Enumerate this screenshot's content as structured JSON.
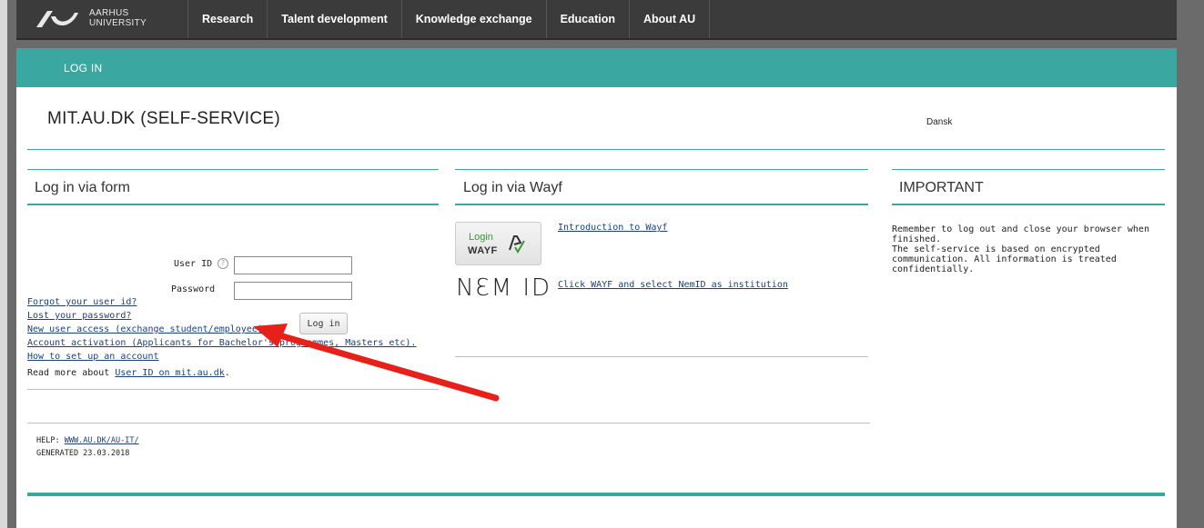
{
  "topbar": {
    "logo_line1": "AARHUS",
    "logo_line2": "UNIVERSITY",
    "nav": [
      "Research",
      "Talent development",
      "Knowledge exchange",
      "Education",
      "About AU"
    ]
  },
  "strip": {
    "label": "LOG IN"
  },
  "page": {
    "title": "MIT.AU.DK (SELF-SERVICE)",
    "language": "Dansk"
  },
  "form": {
    "heading": "Log in via form",
    "userid_label": "User ID",
    "help_icon": "?",
    "password_label": "Password",
    "userid_value": "",
    "password_value": "",
    "login_button": "Log in",
    "links": [
      "Forgot your user id?",
      "Lost your password?",
      "New user access (exchange student/employee).",
      "Account activation (Applicants for Bachelor's programmes, Masters etc).",
      "How to set up an account"
    ],
    "read_more_prefix": "Read more about ",
    "read_more_link": "User ID on mit.au.dk",
    "read_more_suffix": "."
  },
  "wayf": {
    "heading": "Log in via Wayf",
    "button_top": "Login",
    "button_bottom": "WAYF",
    "intro_link": "Introduction to Wayf",
    "nemid_logo": "NƐM ID",
    "nemid_link": "Click WAYF and select NemID as institution"
  },
  "important": {
    "heading": "IMPORTANT",
    "text": "Remember to log out and close your browser when finished.\nThe self-service is based on encrypted communication. All information is treated confidentially."
  },
  "footer": {
    "help_label": "HELP:",
    "help_link": "WWW.AU.DK/AU-IT/",
    "generated": "GENERATED 23.03.2018"
  },
  "colors": {
    "teal": "#3aa7a0",
    "topbar": "#3b3b3b",
    "arrow": "#e8201a"
  },
  "icons": {
    "logo": "aarhus-wave-logo",
    "help": "help-circle-icon",
    "wayf": "wayf-logo-icon",
    "arrow": "red-annotation-arrow"
  }
}
